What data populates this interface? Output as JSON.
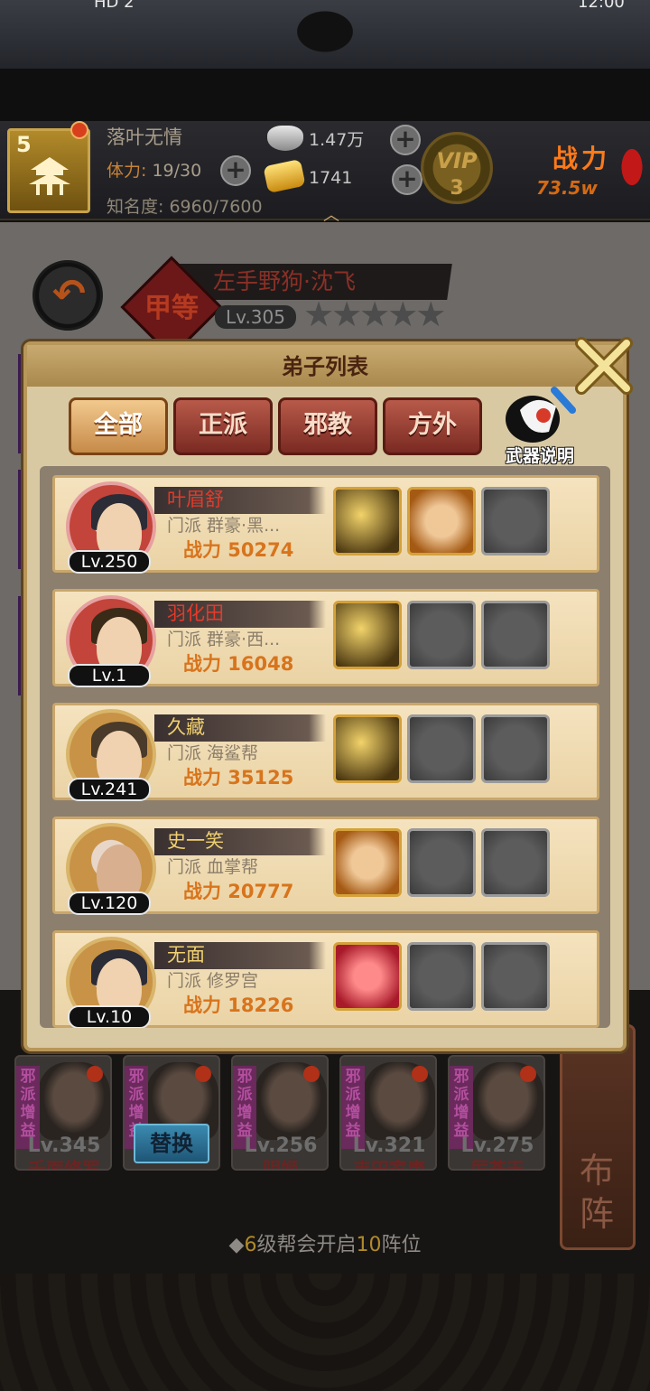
{
  "status_bar": {
    "left_text": "HD 2",
    "right_text": "12:00"
  },
  "player": {
    "level": "5",
    "name": "落叶无情",
    "stamina_label": "体力:",
    "stamina_value": "19/30",
    "fame": "知名度: 6960/7600",
    "silver": "1.47万",
    "gold": "1741",
    "vip_label": "VIP",
    "vip_level": "3",
    "power_label": "战力",
    "power_value": "73.5w"
  },
  "hero": {
    "grade": "甲等",
    "name": "左手野狗·沈飞",
    "level": "Lv.305",
    "stars": "★★★★★"
  },
  "panel": {
    "title": "弟子列表",
    "tabs": [
      "全部",
      "正派",
      "邪教",
      "方外"
    ],
    "active_tab": "全部",
    "weapon_info_label": "武器说明",
    "disciples": [
      {
        "name": "叶眉舒",
        "sect": "门派  群豪·黑...",
        "power": "战力 50274",
        "level": "Lv.250"
      },
      {
        "name": "羽化田",
        "sect": "门派  群豪·西...",
        "power": "战力 16048",
        "level": "Lv.1"
      },
      {
        "name": "久藏",
        "sect": "门派  海鲨帮",
        "power": "战力 35125",
        "level": "Lv.241"
      },
      {
        "name": "史一笑",
        "sect": "门派  血掌帮",
        "power": "战力 20777",
        "level": "Lv.120"
      },
      {
        "name": "无面",
        "sect": "门派  修罗宫",
        "power": "战力 18226",
        "level": "Lv.10"
      }
    ]
  },
  "team": {
    "badge": "邪派增益",
    "members": [
      {
        "level": "Lv.345",
        "name": "千面修罗"
      },
      {
        "level": "",
        "name": "",
        "action": "替换"
      },
      {
        "level": "Lv.256",
        "name": "阴姬"
      },
      {
        "level": "Lv.321",
        "name": "丰田家康"
      },
      {
        "level": "Lv.275",
        "name": "厉苍天"
      }
    ],
    "formation_label": "布阵"
  },
  "footer": {
    "prefix": "◆",
    "num1": "6",
    "mid": "级帮会开启",
    "num2": "10",
    "suffix": "阵位"
  },
  "colors": {
    "accent_gold": "#c9a44b",
    "power_orange": "#d8741c",
    "name_red": "#e43a2a"
  }
}
